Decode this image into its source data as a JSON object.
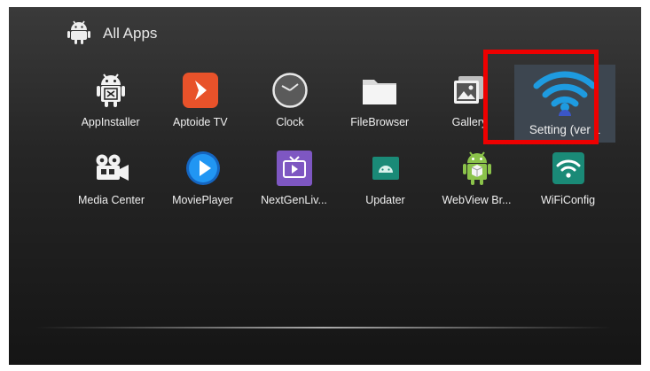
{
  "header": {
    "title": "All Apps",
    "icon": "android-icon"
  },
  "apps_row1": [
    {
      "label": "AppInstaller",
      "icon": "app-installer-icon"
    },
    {
      "label": "Aptoide TV",
      "icon": "aptoide-icon"
    },
    {
      "label": "Clock",
      "icon": "clock-icon"
    },
    {
      "label": "FileBrowser",
      "icon": "folder-icon"
    },
    {
      "label": "Gallery",
      "icon": "gallery-icon"
    },
    {
      "label": "Setting (ver 1",
      "icon": "wifi-settings-icon",
      "selected": true
    }
  ],
  "apps_row2": [
    {
      "label": "Media Center",
      "icon": "media-center-icon"
    },
    {
      "label": "MoviePlayer",
      "icon": "movie-player-icon"
    },
    {
      "label": "NextGenLiv...",
      "icon": "tv-icon"
    },
    {
      "label": "Updater",
      "icon": "updater-icon"
    },
    {
      "label": "WebView Br...",
      "icon": "webview-icon"
    },
    {
      "label": "WiFiConfig",
      "icon": "wifi-config-icon"
    }
  ],
  "colors": {
    "highlight": "#ee0000",
    "selected_bg": "#3d4650",
    "aptoide": "#e8522a",
    "wifi_blue": "#1e9be0",
    "teal": "#1a8a77"
  }
}
